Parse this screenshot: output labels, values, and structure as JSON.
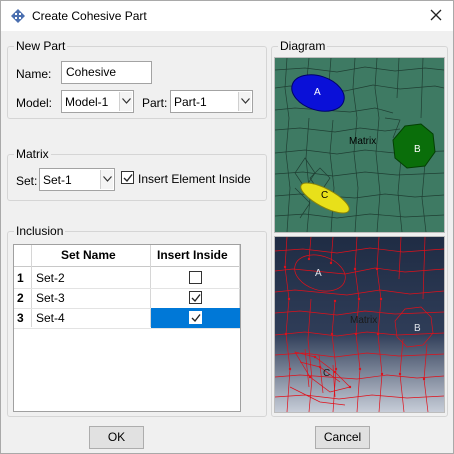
{
  "window": {
    "title": "Create Cohesive Part",
    "close_icon": "close-icon"
  },
  "new_part": {
    "legend": "New Part",
    "name_label": "Name:",
    "name_value": "Cohesive",
    "model_label": "Model:",
    "model_value": "Model-1",
    "part_label": "Part:",
    "part_value": "Part-1"
  },
  "matrix": {
    "legend": "Matrix",
    "set_label": "Set:",
    "set_value": "Set-1",
    "insert_label": "Insert Element Inside",
    "insert_checked": true
  },
  "inclusion": {
    "legend": "Inclusion",
    "columns": [
      "Set Name",
      "Insert Inside"
    ],
    "rows": [
      {
        "index": "1",
        "set": "Set-2",
        "checked": false,
        "selected": false
      },
      {
        "index": "2",
        "set": "Set-3",
        "checked": true,
        "selected": false
      },
      {
        "index": "3",
        "set": "Set-4",
        "checked": true,
        "selected": true
      }
    ]
  },
  "diagram": {
    "legend": "Diagram",
    "top_labels": {
      "a": "A",
      "b": "B",
      "c": "C",
      "matrix": "Matrix"
    },
    "bottom_labels": {
      "a": "A",
      "b": "B",
      "c": "C",
      "matrix": "Matrix"
    },
    "colors": {
      "mesh_green": "#3e7a63",
      "inclusion_a": "#0a10d8",
      "inclusion_b": "#0a6e0a",
      "inclusion_c": "#e8e01a",
      "cohesive_red": "#e0101a",
      "bottom_bg_top": "#1f2c44",
      "bottom_bg_bottom": "#c7cdd8"
    }
  },
  "buttons": {
    "ok": "OK",
    "cancel": "Cancel"
  },
  "accent": {
    "selection": "#0078d7"
  }
}
